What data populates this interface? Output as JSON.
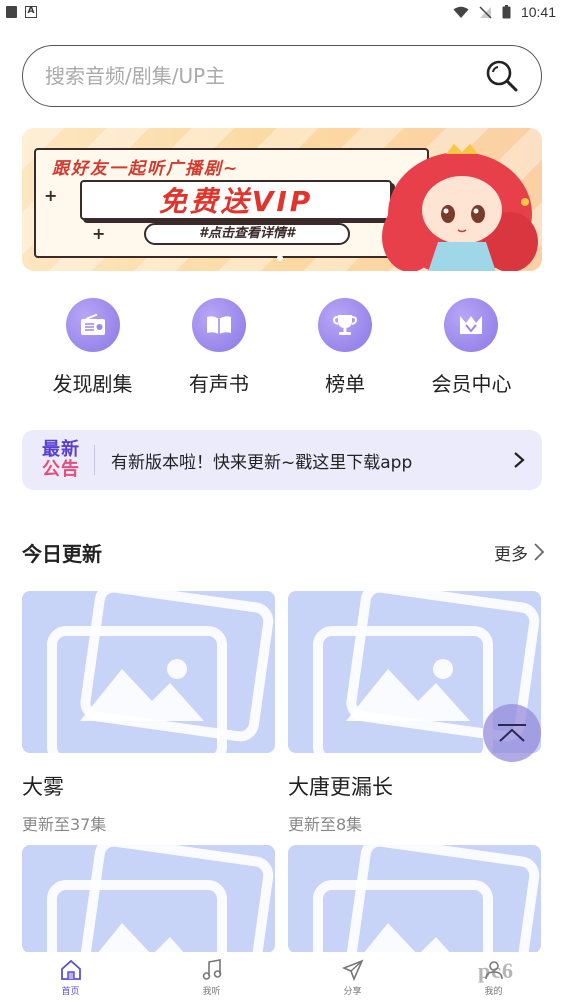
{
  "status_bar": {
    "time": "10:41"
  },
  "search": {
    "placeholder": "搜索音频/剧集/UP主"
  },
  "banner": {
    "line1": "跟好友一起听广播剧~",
    "headline": "免费送VIP",
    "detail": "#点击查看详情#"
  },
  "quick_nav": [
    {
      "label": "发现剧集",
      "icon": "radio-icon"
    },
    {
      "label": "有声书",
      "icon": "book-icon"
    },
    {
      "label": "榜单",
      "icon": "trophy-icon"
    },
    {
      "label": "会员中心",
      "icon": "crown-icon"
    }
  ],
  "notice": {
    "tag_line1": "最新",
    "tag_line2": "公告",
    "text": "有新版本啦！快来更新~戳这里下载app"
  },
  "today": {
    "title": "今日更新",
    "more": "更多",
    "items": [
      {
        "title": "大雾",
        "subtitle": "更新至37集"
      },
      {
        "title": "大唐更漏长",
        "subtitle": "更新至8集"
      },
      {
        "title": "",
        "subtitle": ""
      },
      {
        "title": "",
        "subtitle": ""
      }
    ]
  },
  "tabbar": [
    {
      "label": "首页",
      "icon": "home-icon",
      "active": true
    },
    {
      "label": "我听",
      "icon": "music-note-icon",
      "active": false
    },
    {
      "label": "分享",
      "icon": "paper-plane-icon",
      "active": false
    },
    {
      "label": "我的",
      "icon": "user-icon",
      "active": false
    }
  ],
  "watermark": "pc6",
  "colors": {
    "accent": "#8c78e6",
    "placeholder_bg": "#c7d3f7",
    "notice_bg": "#ecebfb"
  }
}
